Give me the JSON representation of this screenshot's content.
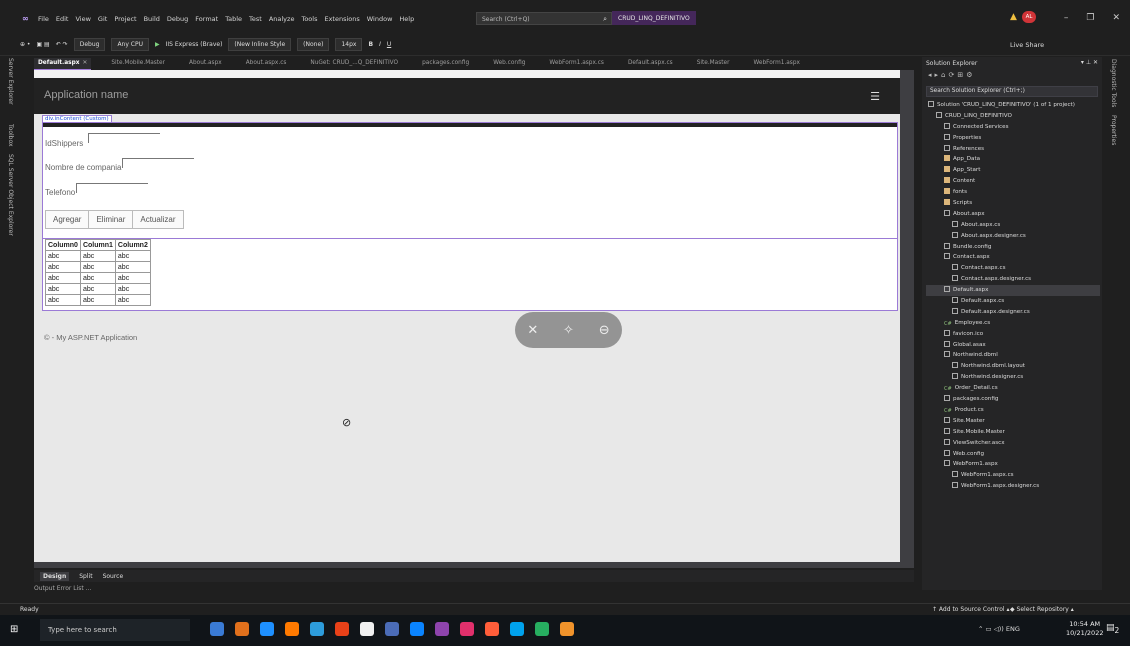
{
  "menubar": {
    "logo": "∞",
    "items": [
      "File",
      "Edit",
      "View",
      "Git",
      "Project",
      "Build",
      "Debug",
      "Format",
      "Table",
      "Test",
      "Analyze",
      "Tools",
      "Extensions",
      "Window",
      "Help"
    ],
    "search_placeholder": "Search (Ctrl+Q)",
    "solution_name": "CRUD_LINQ_DEFINITIVO",
    "avatar_initials": "AL"
  },
  "toolbar": {
    "config": "Debug",
    "platform": "Any CPU",
    "run_target": "IIS Express (Brave)",
    "style": "(New Inline Style",
    "target_rule": "(None)",
    "font_size": "14px",
    "live_share": "Live Share"
  },
  "left_strip": [
    "Server Explorer",
    "Toolbox",
    "SQL Server Object Explorer"
  ],
  "right_strip": [
    "Diagnostic Tools",
    "Properties"
  ],
  "tabs": [
    {
      "label": "Default.aspx",
      "active": true
    },
    {
      "label": "Site.Mobile.Master",
      "active": false
    },
    {
      "label": "About.aspx",
      "active": false
    },
    {
      "label": "About.aspx.cs",
      "active": false
    },
    {
      "label": "NuGet: CRUD_...Q_DEFINITIVO",
      "active": false
    },
    {
      "label": "packages.config",
      "active": false
    },
    {
      "label": "Web.config",
      "active": false
    },
    {
      "label": "WebForm1.aspx.cs",
      "active": false
    },
    {
      "label": "Default.aspx.cs",
      "active": false
    },
    {
      "label": "Site.Master",
      "active": false
    },
    {
      "label": "WebForm1.aspx",
      "active": false
    }
  ],
  "designer": {
    "app_name": "Application name",
    "div_tag": "div.inContent (Custom)",
    "fields": {
      "idshippers": "IdShippers",
      "company": "Nombre de compania",
      "phone": "Telefono"
    },
    "buttons": {
      "add": "Agregar",
      "delete": "Eliminar",
      "update": "Actualizar"
    },
    "grid": {
      "columns": [
        "Column0",
        "Column1",
        "Column2"
      ],
      "rows": [
        [
          "abc",
          "abc",
          "abc"
        ],
        [
          "abc",
          "abc",
          "abc"
        ],
        [
          "abc",
          "abc",
          "abc"
        ],
        [
          "abc",
          "abc",
          "abc"
        ],
        [
          "abc",
          "abc",
          "abc"
        ]
      ]
    },
    "footer": "© - My ASP.NET Application"
  },
  "view_modes": {
    "design": "Design",
    "split": "Split",
    "source": "Source"
  },
  "bottom_tabs": "Output   Error List ...",
  "solution_explorer": {
    "title": "Solution Explorer",
    "search_placeholder": "Search Solution Explorer (Ctrl+;)",
    "nodes": [
      {
        "indent": 0,
        "icon": "file",
        "label": "Solution 'CRUD_LINQ_DEFINITIVO' (1 of 1 project)"
      },
      {
        "indent": 1,
        "icon": "file",
        "label": "CRUD_LINQ_DEFINITIVO"
      },
      {
        "indent": 2,
        "icon": "file",
        "label": "Connected Services"
      },
      {
        "indent": 2,
        "icon": "file",
        "label": "Properties"
      },
      {
        "indent": 2,
        "icon": "file",
        "label": "References"
      },
      {
        "indent": 2,
        "icon": "folder",
        "label": "App_Data"
      },
      {
        "indent": 2,
        "icon": "folder",
        "label": "App_Start"
      },
      {
        "indent": 2,
        "icon": "folder",
        "label": "Content"
      },
      {
        "indent": 2,
        "icon": "folder",
        "label": "fonts"
      },
      {
        "indent": 2,
        "icon": "folder",
        "label": "Scripts"
      },
      {
        "indent": 2,
        "icon": "file",
        "label": "About.aspx"
      },
      {
        "indent": 3,
        "icon": "file",
        "label": "About.aspx.cs"
      },
      {
        "indent": 3,
        "icon": "file",
        "label": "About.aspx.designer.cs"
      },
      {
        "indent": 2,
        "icon": "file",
        "label": "Bundle.config"
      },
      {
        "indent": 2,
        "icon": "file",
        "label": "Contact.aspx"
      },
      {
        "indent": 3,
        "icon": "file",
        "label": "Contact.aspx.cs"
      },
      {
        "indent": 3,
        "icon": "file",
        "label": "Contact.aspx.designer.cs"
      },
      {
        "indent": 2,
        "icon": "file",
        "label": "Default.aspx",
        "selected": true
      },
      {
        "indent": 3,
        "icon": "file",
        "label": "Default.aspx.cs"
      },
      {
        "indent": 3,
        "icon": "file",
        "label": "Default.aspx.designer.cs"
      },
      {
        "indent": 2,
        "icon": "cs",
        "label": "Employee.cs"
      },
      {
        "indent": 2,
        "icon": "file",
        "label": "favicon.ico"
      },
      {
        "indent": 2,
        "icon": "file",
        "label": "Global.asax"
      },
      {
        "indent": 2,
        "icon": "file",
        "label": "Northwind.dbml"
      },
      {
        "indent": 3,
        "icon": "file",
        "label": "Northwind.dbml.layout"
      },
      {
        "indent": 3,
        "icon": "file",
        "label": "Northwind.designer.cs"
      },
      {
        "indent": 2,
        "icon": "cs",
        "label": "Order_Detail.cs"
      },
      {
        "indent": 2,
        "icon": "file",
        "label": "packages.config"
      },
      {
        "indent": 2,
        "icon": "cs",
        "label": "Product.cs"
      },
      {
        "indent": 2,
        "icon": "file",
        "label": "Site.Master"
      },
      {
        "indent": 2,
        "icon": "file",
        "label": "Site.Mobile.Master"
      },
      {
        "indent": 2,
        "icon": "file",
        "label": "ViewSwitcher.ascx"
      },
      {
        "indent": 2,
        "icon": "file",
        "label": "Web.config"
      },
      {
        "indent": 2,
        "icon": "file",
        "label": "WebForm1.aspx"
      },
      {
        "indent": 3,
        "icon": "file",
        "label": "WebForm1.aspx.cs"
      },
      {
        "indent": 3,
        "icon": "file",
        "label": "WebForm1.aspx.designer.cs"
      }
    ]
  },
  "statusbar": {
    "ready": "Ready",
    "source_control": "↑ Add to Source Control ▴",
    "repository": "◆ Select Repository ▴"
  },
  "taskbar": {
    "search_placeholder": "Type here to search",
    "app_colors": [
      "#3a7bd5",
      "#e0701c",
      "#1e90ff",
      "#ff7a00",
      "#2d9cdb",
      "#e84118",
      "#f0f0f0",
      "#4b6cb7",
      "#0a84ff",
      "#8e44ad",
      "#e1306c",
      "#ff5e3a",
      "#00a2ed",
      "#27ae60",
      "#f0932b"
    ],
    "lang": "ENG",
    "time": "10:54 AM",
    "date": "10/21/2022",
    "notifications": "2"
  }
}
